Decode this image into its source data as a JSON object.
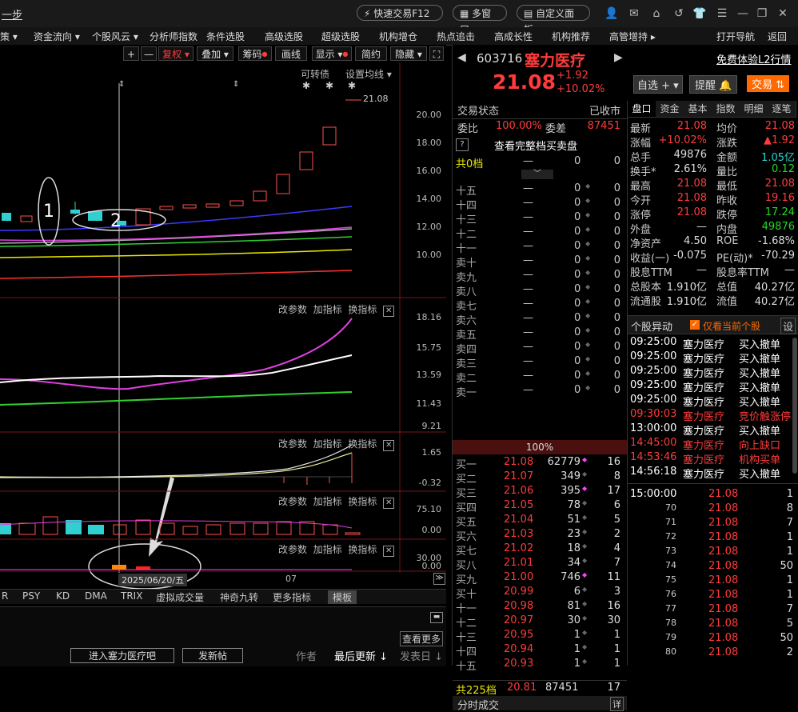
{
  "title_bar": {
    "left_text": "一步",
    "buttons": [
      "快速交易F12",
      "多窗口",
      "自定义面板"
    ],
    "icons": [
      "user-icon",
      "mail-icon",
      "home-icon",
      "back-icon",
      "shirt-icon",
      "menu-icon",
      "minimize-icon",
      "restore-icon",
      "close-icon"
    ]
  },
  "menu": {
    "items": [
      "策 ▾",
      "资金流向 ▾",
      "个股风云 ▾",
      "分析师指数",
      "条件选股",
      "高级选股",
      "超级选股",
      "机构增仓",
      "热点追击",
      "高成长性",
      "机构推荐",
      "高管增持 ▸"
    ],
    "right": [
      "打开导航",
      "返回"
    ]
  },
  "chart_toolbar": {
    "buttons": [
      "+",
      "—",
      "复权 ▾",
      "叠加 ▾",
      "筹码",
      "画线",
      "显示 ▾",
      "简约",
      "隐藏 ▾",
      "⛶"
    ]
  },
  "main_panel": {
    "links": [
      "可转债",
      "设置均线 ▾"
    ],
    "last_price_label": "21.08",
    "y_ticks": [
      "20.00",
      "18.00",
      "16.00",
      "14.00",
      "12.00",
      "10.00"
    ],
    "annotations": [
      "1",
      "2"
    ],
    "markers": [
      "⇕",
      "⇕",
      "✱",
      "✱",
      "✱"
    ]
  },
  "panel2": {
    "tools": [
      "改参数",
      "加指标",
      "换指标"
    ],
    "y_ticks": [
      "18.16",
      "15.75",
      "13.59",
      "11.43",
      "9.21"
    ]
  },
  "panel3": {
    "tools": [
      "改参数",
      "加指标",
      "换指标"
    ],
    "y_ticks": [
      "1.65",
      "-0.32"
    ]
  },
  "panel4": {
    "tools": [
      "改参数",
      "加指标",
      "换指标"
    ],
    "y_ticks": [
      "75.10",
      "0.00"
    ]
  },
  "panel5": {
    "tools": [
      "改参数",
      "加指标",
      "换指标"
    ],
    "y_ticks": [
      "30.00",
      "0.00"
    ]
  },
  "date_label": "2025/06/20/五",
  "x_label": "07",
  "indicators": [
    "R",
    "PSY",
    "KD",
    "DMA",
    "TRIX",
    "虚拟成交量",
    "神奇九转",
    "更多指标",
    "模板"
  ],
  "lower": {
    "more": "查看更多",
    "forum_button": "进入塞力医疗吧",
    "post_button": "发新帖",
    "cols": [
      "作者",
      "最后更新 ↓",
      "发表日 ↓"
    ]
  },
  "stock": {
    "code": "603716",
    "name": "塞力医疗",
    "price": "21.08",
    "change": "+1.92",
    "change_pct": "+10.02%",
    "l2_link": "免费体验L2行情",
    "buttons": [
      "自选 + ▾",
      "提醒 🔔",
      "交易 ⇅"
    ]
  },
  "order_book": {
    "status_label": "交易状态",
    "status_value": "已收市",
    "weibi_label": "委比",
    "weibi_value": "100.00%",
    "weicha_label": "委差",
    "weicha_value": "87451",
    "full_book": "查看完整档买卖盘",
    "total_sell": [
      "共0档",
      "—",
      "0",
      "0"
    ],
    "sell": [
      [
        "十五",
        "—",
        "0",
        "0"
      ],
      [
        "十四",
        "—",
        "0",
        "0"
      ],
      [
        "十三",
        "—",
        "0",
        "0"
      ],
      [
        "十二",
        "—",
        "0",
        "0"
      ],
      [
        "十一",
        "—",
        "0",
        "0"
      ],
      [
        "卖十",
        "—",
        "0",
        "0"
      ],
      [
        "卖九",
        "—",
        "0",
        "0"
      ],
      [
        "卖八",
        "—",
        "0",
        "0"
      ],
      [
        "卖七",
        "—",
        "0",
        "0"
      ],
      [
        "卖六",
        "—",
        "0",
        "0"
      ],
      [
        "卖五",
        "—",
        "0",
        "0"
      ],
      [
        "卖四",
        "—",
        "0",
        "0"
      ],
      [
        "卖三",
        "—",
        "0",
        "0"
      ],
      [
        "卖二",
        "—",
        "0",
        "0"
      ],
      [
        "卖一",
        "—",
        "0",
        "0"
      ]
    ],
    "ratio": "100%",
    "buy": [
      [
        "买一",
        "21.08",
        "62779",
        "16"
      ],
      [
        "买二",
        "21.07",
        "349",
        "8"
      ],
      [
        "买三",
        "21.06",
        "395",
        "17"
      ],
      [
        "买四",
        "21.05",
        "78",
        "6"
      ],
      [
        "买五",
        "21.04",
        "51",
        "5"
      ],
      [
        "买六",
        "21.03",
        "23",
        "2"
      ],
      [
        "买七",
        "21.02",
        "18",
        "4"
      ],
      [
        "买八",
        "21.01",
        "34",
        "7"
      ],
      [
        "买九",
        "21.00",
        "746",
        "11"
      ],
      [
        "买十",
        "20.99",
        "6",
        "3"
      ],
      [
        "十一",
        "20.98",
        "81",
        "16"
      ],
      [
        "十二",
        "20.97",
        "30",
        "30"
      ],
      [
        "十三",
        "20.95",
        "1",
        "1"
      ],
      [
        "十四",
        "20.94",
        "1",
        "1"
      ],
      [
        "十五",
        "20.93",
        "1",
        "1"
      ]
    ],
    "total_buy": [
      "共225档",
      "20.81",
      "87451",
      "17"
    ],
    "fenshi": "分时成交",
    "fenshi_btn": "详"
  },
  "tabs": [
    "盘口",
    "资金",
    "基本",
    "指数",
    "明细",
    "逐笔"
  ],
  "stats": [
    [
      "最新",
      "21.08",
      "均价",
      "21.08"
    ],
    [
      "涨幅",
      "+10.02%",
      "涨跌",
      "▲1.92"
    ],
    [
      "总手",
      "49876",
      "金额",
      "1.05亿"
    ],
    [
      "换手*",
      "2.61%",
      "量比",
      "0.12"
    ],
    [
      "最高",
      "21.08",
      "最低",
      "21.08"
    ],
    [
      "今开",
      "21.08",
      "昨收",
      "19.16"
    ],
    [
      "涨停",
      "21.08",
      "跌停",
      "17.24"
    ],
    [
      "外盘",
      "—",
      "内盘",
      "49876"
    ],
    [
      "净资产",
      "4.50",
      "ROE",
      "-1.68%"
    ],
    [
      "收益(一)",
      "-0.075",
      "PE(动)*",
      "-70.29"
    ],
    [
      "股息TTM",
      "—",
      "股息率TTM",
      "—"
    ],
    [
      "总股本",
      "1.910亿",
      "总值",
      "40.27亿"
    ],
    [
      "流通股",
      "1.910亿",
      "流值",
      "40.27亿"
    ]
  ],
  "anomaly": {
    "title": "个股异动",
    "checkbox": "仅看当前个股",
    "settings": "设",
    "rows": [
      [
        "09:25:00",
        "塞力医疗",
        "买入撤单"
      ],
      [
        "09:25:00",
        "塞力医疗",
        "买入撤单"
      ],
      [
        "09:25:00",
        "塞力医疗",
        "买入撤单"
      ],
      [
        "09:25:00",
        "塞力医疗",
        "买入撤单"
      ],
      [
        "09:25:00",
        "塞力医疗",
        "买入撤单"
      ],
      [
        "09:30:03",
        "塞力医疗",
        "竞价触涨停"
      ],
      [
        "13:00:00",
        "塞力医疗",
        "买入撤单"
      ],
      [
        "14:45:00",
        "塞力医疗",
        "向上缺口"
      ],
      [
        "14:53:46",
        "塞力医疗",
        "机构买单"
      ],
      [
        "14:56:18",
        "塞力医疗",
        "买入撤单"
      ]
    ]
  },
  "ticks": [
    [
      "15:00:00",
      "21.08",
      "1"
    ],
    [
      "70",
      "21.08",
      "8"
    ],
    [
      "71",
      "21.08",
      "7"
    ],
    [
      "72",
      "21.08",
      "1"
    ],
    [
      "73",
      "21.08",
      "1"
    ],
    [
      "74",
      "21.08",
      "50"
    ],
    [
      "75",
      "21.08",
      "1"
    ],
    [
      "76",
      "21.08",
      "1"
    ],
    [
      "77",
      "21.08",
      "7"
    ],
    [
      "78",
      "21.08",
      "5"
    ],
    [
      "79",
      "21.08",
      "50"
    ],
    [
      "80",
      "21.08",
      "2"
    ]
  ],
  "colors": {
    "up": "#ff3b3b",
    "down": "#27d827",
    "accent": "#ff8800"
  }
}
